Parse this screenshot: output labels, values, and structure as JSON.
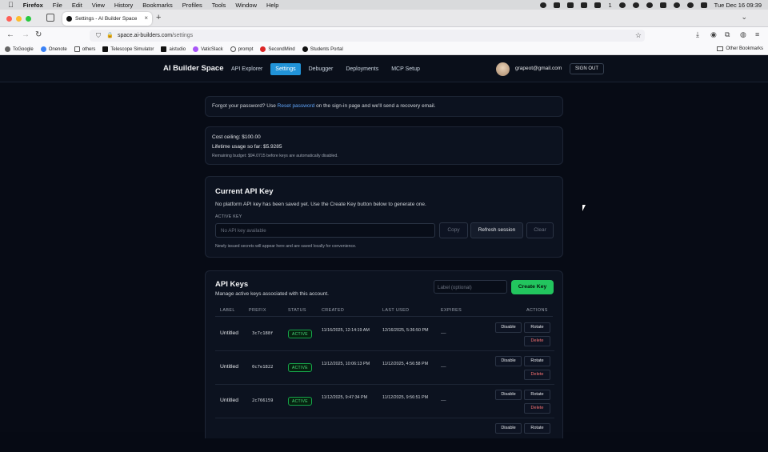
{
  "menubar": {
    "items": [
      "Firefox",
      "File",
      "Edit",
      "View",
      "History",
      "Bookmarks",
      "Profiles",
      "Tools",
      "Window",
      "Help"
    ],
    "clock": "Tue Dec 16  09:39",
    "battery": "1"
  },
  "browser": {
    "tab_title": "Settings - AI Builder Space",
    "url_host": "space.ai-builders.com",
    "url_path": "/settings",
    "bookmarks": [
      "ToGoogle",
      "Onenote",
      "others",
      "Telescope Simulator",
      "aistudio",
      "VaticSlack",
      "prompt",
      "SecondMind",
      "Students Portal"
    ],
    "other_bookmarks": "Other Bookmarks"
  },
  "header": {
    "brand": "AI Builder Space",
    "nav": [
      "API Explorer",
      "Settings",
      "Debugger",
      "Deployments",
      "MCP Setup"
    ],
    "active_nav": "Settings",
    "email": "grapeot@gmail.com",
    "signout": "SIGN OUT"
  },
  "password_notice": {
    "prefix": "Forgot your password? Use ",
    "link": "Reset password",
    "suffix": " on the sign-in page and we'll send a recovery email."
  },
  "budget": {
    "ceiling": "Cost ceiling: $100.00",
    "usage": "Lifetime usage so far: $5.9285",
    "remaining": "Remaining budget: $94.0715 before keys are automatically disabled."
  },
  "current_key": {
    "title": "Current API Key",
    "description": "No platform API key has been saved yet. Use the Create Key button below to generate one.",
    "active_label": "ACTIVE KEY",
    "input_placeholder": "No API key available",
    "copy": "Copy",
    "refresh": "Refresh session",
    "clear": "Clear",
    "note": "Newly issued secrets will appear here and are saved locally for convenience."
  },
  "api_keys": {
    "title": "API Keys",
    "description": "Manage active keys associated with this account.",
    "label_placeholder": "Label (optional)",
    "create": "Create Key",
    "columns": [
      "LABEL",
      "PREFIX",
      "STATUS",
      "CREATED",
      "LAST USED",
      "EXPIRES",
      "ACTIONS"
    ],
    "rows": [
      {
        "label": "Untitled",
        "prefix": "3c7c188f",
        "status": "ACTIVE",
        "created": "11/16/2025, 12:14:19 AM",
        "last_used": "12/16/2025, 5:36:50 PM",
        "expires": "—"
      },
      {
        "label": "Untitled",
        "prefix": "0c7e1822",
        "status": "ACTIVE",
        "created": "11/12/2025, 10:06:13 PM",
        "last_used": "11/12/2025, 4:56:58 PM",
        "expires": "—"
      },
      {
        "label": "Untitled",
        "prefix": "2c766159",
        "status": "ACTIVE",
        "created": "11/12/2025, 9:47:34 PM",
        "last_used": "11/12/2025, 9:56:51 PM",
        "expires": "—"
      }
    ],
    "actions": {
      "disable": "Disable",
      "rotate": "Rotate",
      "delete": "Delete"
    }
  },
  "colors": {
    "accent": "#2193d8",
    "create": "#22c55e",
    "active_badge": "#4ade80",
    "link": "#60a5fa"
  }
}
